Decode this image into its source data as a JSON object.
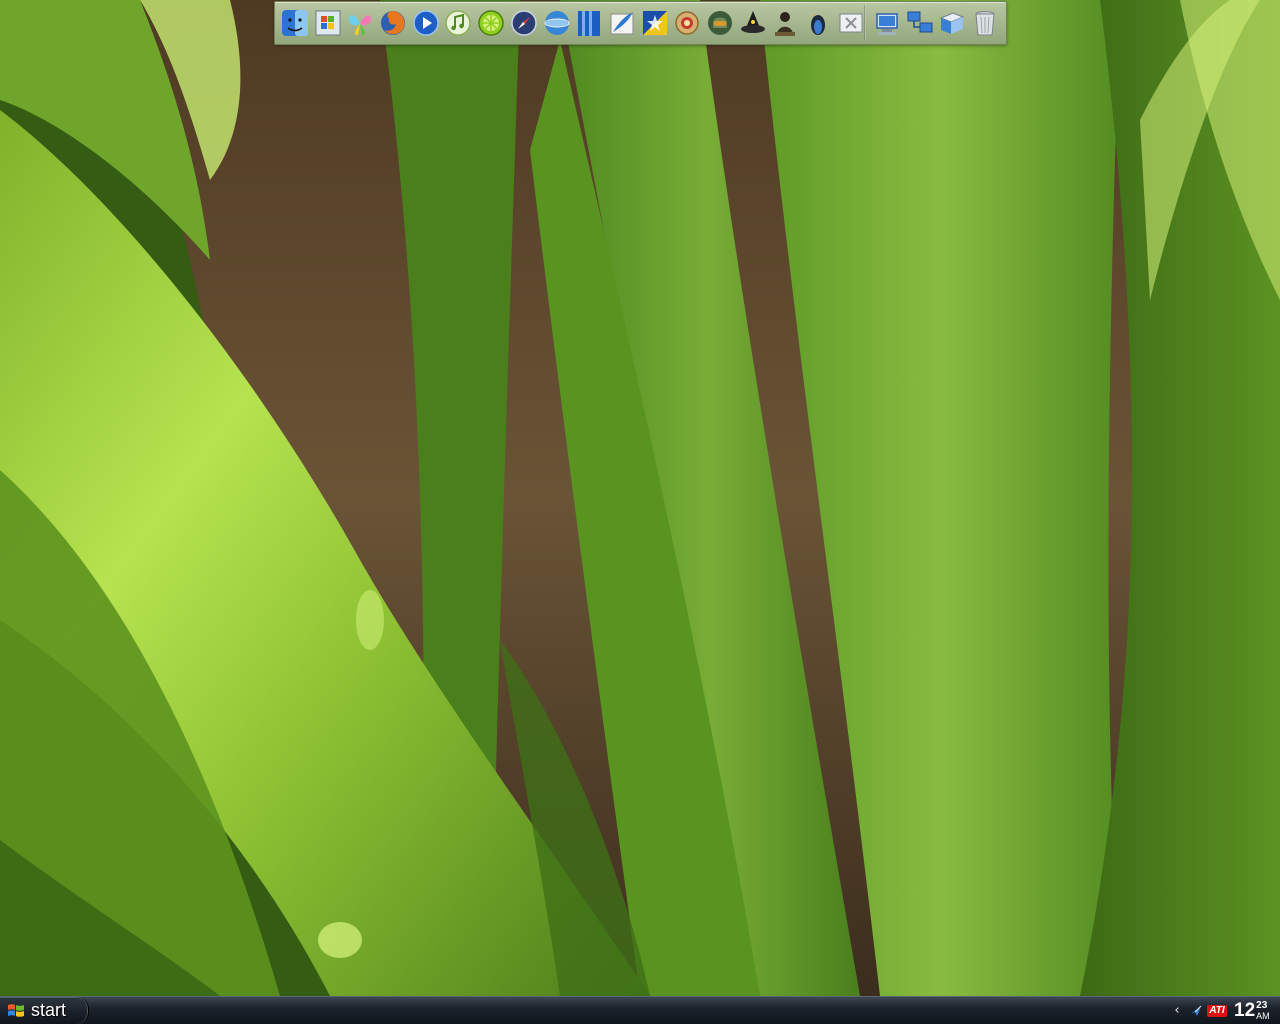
{
  "desktop": {
    "wallpaper": "green-leaves"
  },
  "dock": {
    "app_icons": [
      "finder-icon",
      "windows-explorer-icon",
      "windows-messenger-icon",
      "firefox-icon",
      "media-player-icon",
      "itunes-icon",
      "limewire-icon",
      "safari-compass-icon",
      "globe-icon",
      "blue-book-icon",
      "quill-icon",
      "yellow-star-icon",
      "gear-medal-icon",
      "master-chief-icon",
      "wizard-hat-icon",
      "dark-character-icon",
      "penguin-icon",
      "close-app-icon"
    ],
    "system_icons": [
      "my-computer-icon",
      "network-icon",
      "my-documents-icon",
      "recycle-bin-icon"
    ]
  },
  "taskbar": {
    "start_label": "start",
    "tray": {
      "icons": [
        "show-hidden-icons-chevron",
        "bluetooth-icon",
        "ati-icon"
      ],
      "ati_text": "ATI",
      "chevron": "‹"
    },
    "clock": {
      "hour": "12",
      "minutes": "23",
      "ampm": "AM"
    }
  },
  "colors": {
    "dock_bg": "#a6b78f",
    "taskbar_bg": "#1c232c",
    "leaf_bright": "#a8d64a",
    "leaf_mid": "#6fa02a",
    "leaf_dark": "#3f6b18",
    "soil": "#5e4b33"
  }
}
